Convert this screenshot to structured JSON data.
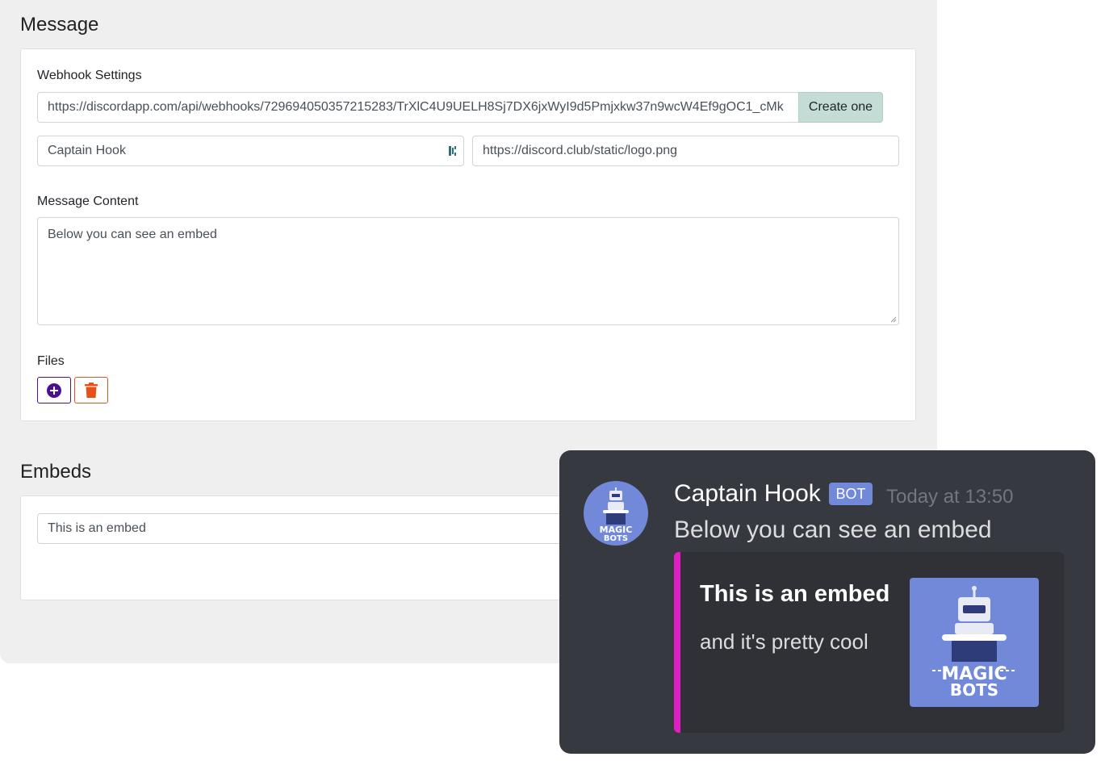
{
  "message_section": {
    "title": "Message",
    "webhook_label": "Webhook Settings",
    "webhook_url": "https://discordapp.com/api/webhooks/729694050357215283/TrXlC4U9UELH8Sj7DX6jxWyI9d5Pmjxkw37n9wcW4Ef9gOC1_cMk",
    "create_button": "Create one",
    "username": "Captain Hook",
    "avatar_url": "https://discord.club/static/logo.png",
    "content_label": "Message Content",
    "content": "Below you can see an embed",
    "files_label": "Files"
  },
  "embeds_section": {
    "title": "Embeds",
    "embed_title_value": "This is an embed"
  },
  "preview": {
    "author": "Captain Hook",
    "badge": "BOT",
    "timestamp": "Today at 13:50",
    "content": "Below you can see an embed",
    "logo_text_1": "MAGIC",
    "logo_text_2": "BOTS",
    "embed": {
      "title": "This is an embed",
      "description": "and it's pretty cool",
      "color": "#e11dc4"
    }
  },
  "colors": {
    "add_button": "#4b0f8f",
    "delete_button": "#e8501a",
    "create_button_bg": "#c4dbd6",
    "discord_bg": "#36393f",
    "blurple": "#7289da"
  },
  "icons": {
    "add": "plus-circle-icon",
    "delete": "trash-icon",
    "password_manager": "password-manager-icon"
  }
}
